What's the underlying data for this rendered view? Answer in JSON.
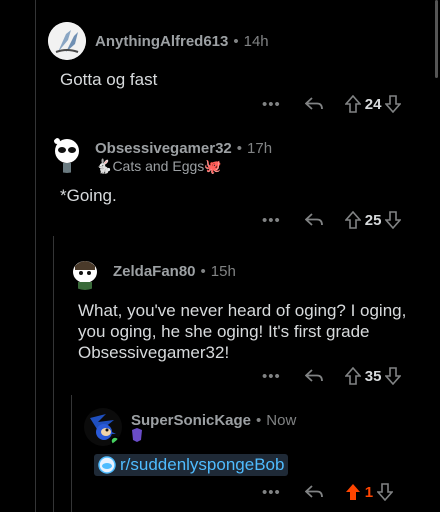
{
  "comments": [
    {
      "author": "AnythingAlfred613",
      "time": "14h",
      "body": "Gotta og fast",
      "score": "24",
      "flair": "",
      "avatar": "alien-avatar"
    },
    {
      "author": "Obsessivegamer32",
      "time": "17h",
      "body": "*Going.",
      "score": "25",
      "flair": "Cats and Eggs",
      "avatar": "panda-avatar"
    },
    {
      "author": "ZeldaFan80",
      "time": "15h",
      "body": "What, you've never heard of oging?  I oging, you oging, he she oging! It's first grade Obsessivegamer32!",
      "score": "35",
      "flair": "",
      "avatar": "snoo-avatar"
    },
    {
      "author": "SuperSonicKage",
      "time": "Now",
      "body": "",
      "score": "1",
      "flair": "",
      "avatar": "sonic-avatar",
      "link": "r/suddenlyspongeBob",
      "upvoted": true
    }
  ],
  "ui": {
    "more_label": "•••",
    "separator": "•"
  },
  "colors": {
    "upvote_active": "#ff4500",
    "link": "#4fbcff",
    "background": "#000000"
  }
}
